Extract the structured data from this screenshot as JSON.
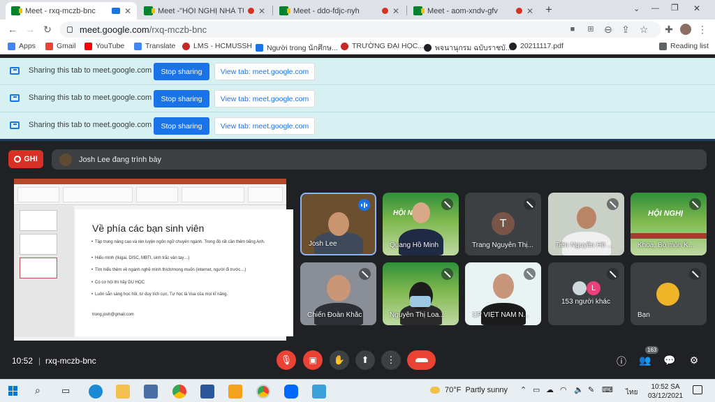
{
  "browser": {
    "tabs": [
      {
        "label": "Meet - rxq-mczb-bnc",
        "indicator": "camera"
      },
      {
        "label": "Meet -\"HỘI NGHỊ NHÀ TUYỂ",
        "indicator": "recording"
      },
      {
        "label": "Meet - ddo-fdjc-nyh",
        "indicator": "recording"
      },
      {
        "label": "Meet - aom-xndv-gfv",
        "indicator": "recording"
      }
    ],
    "new_tab": "+",
    "window_controls": {
      "minimize": "⌄",
      "restore": "—",
      "maximize": "❐",
      "close": "✕"
    },
    "url_host": "meet.google.com",
    "url_path": "/rxq-mczb-bnc",
    "bookmarks": [
      {
        "label": "Apps",
        "color": "#4285f4"
      },
      {
        "label": "Gmail",
        "color": "#ea4335"
      },
      {
        "label": "YouTube",
        "color": "#ff0000"
      },
      {
        "label": "Translate",
        "color": "#4285f4"
      },
      {
        "label": "LMS - HCMUSSH",
        "color": "#c62828"
      },
      {
        "label": "Người trong นักศึกษ...",
        "color": "#1a73e8"
      },
      {
        "label": "TRƯỜNG ĐẠI HỌC...",
        "color": "#c62828"
      },
      {
        "label": "พจนานุกรม ฉบับราชบั...",
        "color": "#202124"
      },
      {
        "label": "20211117.pdf",
        "color": "#202124"
      }
    ],
    "reading_list": "Reading list"
  },
  "share_bars": [
    {
      "text": "Sharing this tab to meet.google.com",
      "stop": "Stop sharing",
      "view": "View tab: meet.google.com"
    },
    {
      "text": "Sharing this tab to meet.google.com",
      "stop": "Stop sharing",
      "view": "View tab: meet.google.com"
    },
    {
      "text": "Sharing this tab to meet.google.com",
      "stop": "Stop sharing",
      "view": "View tab: meet.google.com"
    }
  ],
  "meet": {
    "recording_label": "GHI",
    "presenting_text": "Josh Lee đang trình bày",
    "slide": {
      "title": "Về phía các bạn sinh viên",
      "bullets": [
        "Tập trung nâng cao và rèn luyện ngôn ngữ chuyên ngành. Trong đó rất cần thêm tiếng Anh.",
        "Hiểu mình (Ikigai, DISC, MBTI, sinh trắc vân tay…)",
        "Tìm hiểu thêm về ngành nghề mình thích/mong muốn (internet, người đi trước…)",
        "Có cơ hội thì hãy DU HỌC",
        "Luôn sẵn sàng học hỏi, tư duy tích cực. Tự học là Vua của mọi kĩ năng."
      ],
      "email": "trong.josh@gmail.com"
    },
    "tiles": [
      {
        "name": "Josh Lee",
        "state": "speaking"
      },
      {
        "name": "Quang Hồ Minh",
        "state": "muted",
        "banner": "HỘI NGHỊ"
      },
      {
        "name": "Trang Nguyễn Thị...",
        "state": "muted",
        "initial": "T"
      },
      {
        "name": "Tiến Nguyễn Hồ ...",
        "state": "muted"
      },
      {
        "name": "Khoa, Bộ môn K...",
        "state": "muted",
        "banner": "HỘI NGHỊ"
      },
      {
        "name": "Chiến Đoàn Khắc",
        "state": "muted"
      },
      {
        "name": "Nguyễn Thị Loa...",
        "state": "muted"
      },
      {
        "name": "CP VIỆT NAM N...",
        "state": "muted"
      },
      {
        "name": "153 người khác",
        "state": "muted",
        "initial": "L"
      },
      {
        "name": "Bạn",
        "state": "muted"
      }
    ],
    "time": "10:52",
    "meeting_code": "rxq-mczb-bnc",
    "participants_count": "163"
  },
  "taskbar": {
    "weather_temp": "70°F",
    "weather_text": "Partly sunny",
    "language": "ไทย",
    "time": "10:52 SA",
    "date": "03/12/2021"
  }
}
